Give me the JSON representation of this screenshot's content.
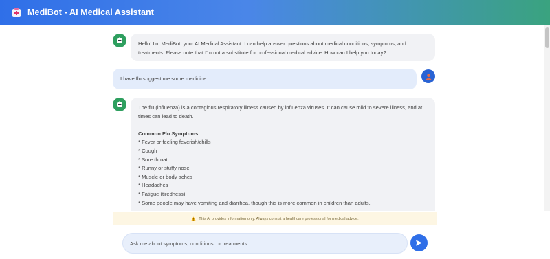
{
  "header": {
    "title": "MediBot - AI Medical Assistant"
  },
  "messages": [
    {
      "role": "bot",
      "text": "Hello! I'm MediBot, your AI Medical Assistant. I can help answer questions about medical conditions, symptoms, and treatments. Please note that I'm not a substitute for professional medical advice. How can I help you today?"
    },
    {
      "role": "user",
      "text": "I have flu suggest me some medicine"
    },
    {
      "role": "bot",
      "intro": "The flu (influenza) is a contagious respiratory illness caused by influenza viruses. It can cause mild to severe illness, and at times can lead to death.",
      "heading": "Common Flu Symptoms:",
      "items": [
        "* Fever or feeling feverish/chills",
        "* Cough",
        "* Sore throat",
        "* Runny or stuffy nose",
        "* Muscle or body aches",
        "* Headaches",
        "* Fatigue (tiredness)",
        "* Some people may have vomiting and diarrhea, though this is more common in children than adults."
      ]
    }
  ],
  "disclaimer": {
    "text": "This AI provides information only. Always consult a healthcare professional for medical advice."
  },
  "input": {
    "placeholder": "Ask me about symptoms, conditions, or treatments...",
    "value": ""
  },
  "icons": {
    "logo": "medical-kit-icon",
    "bot_avatar": "robot-icon",
    "user_avatar": "user-icon",
    "warning": "warning-icon",
    "send": "send-icon"
  },
  "colors": {
    "header_start": "#2f6fe8",
    "header_end": "#3aa37f",
    "bot_avatar": "#2e9f5f",
    "user_avatar": "#2a63d4",
    "bot_bubble": "#f1f2f5",
    "user_bubble": "#e3ecfb",
    "send_button": "#2f6fe8"
  }
}
